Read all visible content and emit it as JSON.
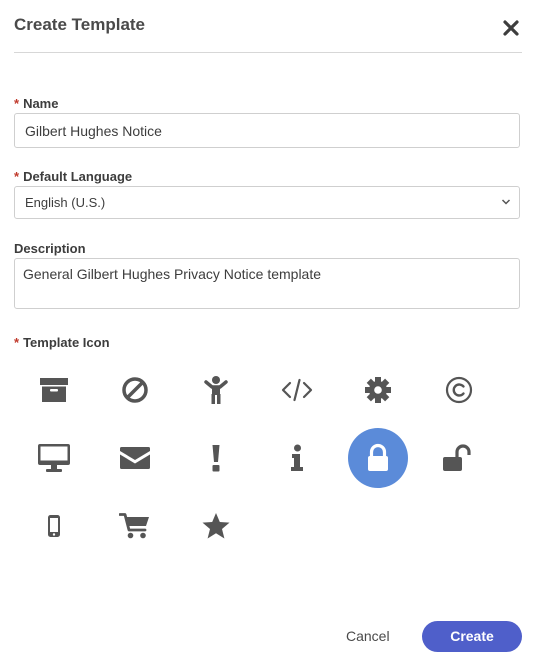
{
  "dialog": {
    "title": "Create Template",
    "close_icon": "close-icon"
  },
  "form": {
    "name_label": "Name",
    "name_value": "Gilbert Hughes Notice",
    "language_label": "Default Language",
    "language_value": "English (U.S.)",
    "description_label": "Description",
    "description_value": "General Gilbert Hughes Privacy Notice template",
    "icon_label": "Template Icon",
    "required_mark": "*"
  },
  "icons": [
    {
      "name": "archive-icon",
      "selected": false
    },
    {
      "name": "ban-icon",
      "selected": false
    },
    {
      "name": "child-icon",
      "selected": false
    },
    {
      "name": "code-icon",
      "selected": false
    },
    {
      "name": "gear-icon",
      "selected": false
    },
    {
      "name": "copyright-icon",
      "selected": false
    },
    {
      "name": "desktop-icon",
      "selected": false
    },
    {
      "name": "envelope-icon",
      "selected": false
    },
    {
      "name": "exclamation-icon",
      "selected": false
    },
    {
      "name": "info-icon",
      "selected": false
    },
    {
      "name": "lock-icon",
      "selected": true
    },
    {
      "name": "unlock-icon",
      "selected": false
    },
    {
      "name": "mobile-icon",
      "selected": false
    },
    {
      "name": "cart-icon",
      "selected": false
    },
    {
      "name": "star-icon",
      "selected": false
    }
  ],
  "colors": {
    "accent": "#4f5fca",
    "selected_icon_bg": "#5b8bd9",
    "icon": "#555555",
    "required": "#c0392b"
  },
  "footer": {
    "cancel_label": "Cancel",
    "create_label": "Create"
  }
}
